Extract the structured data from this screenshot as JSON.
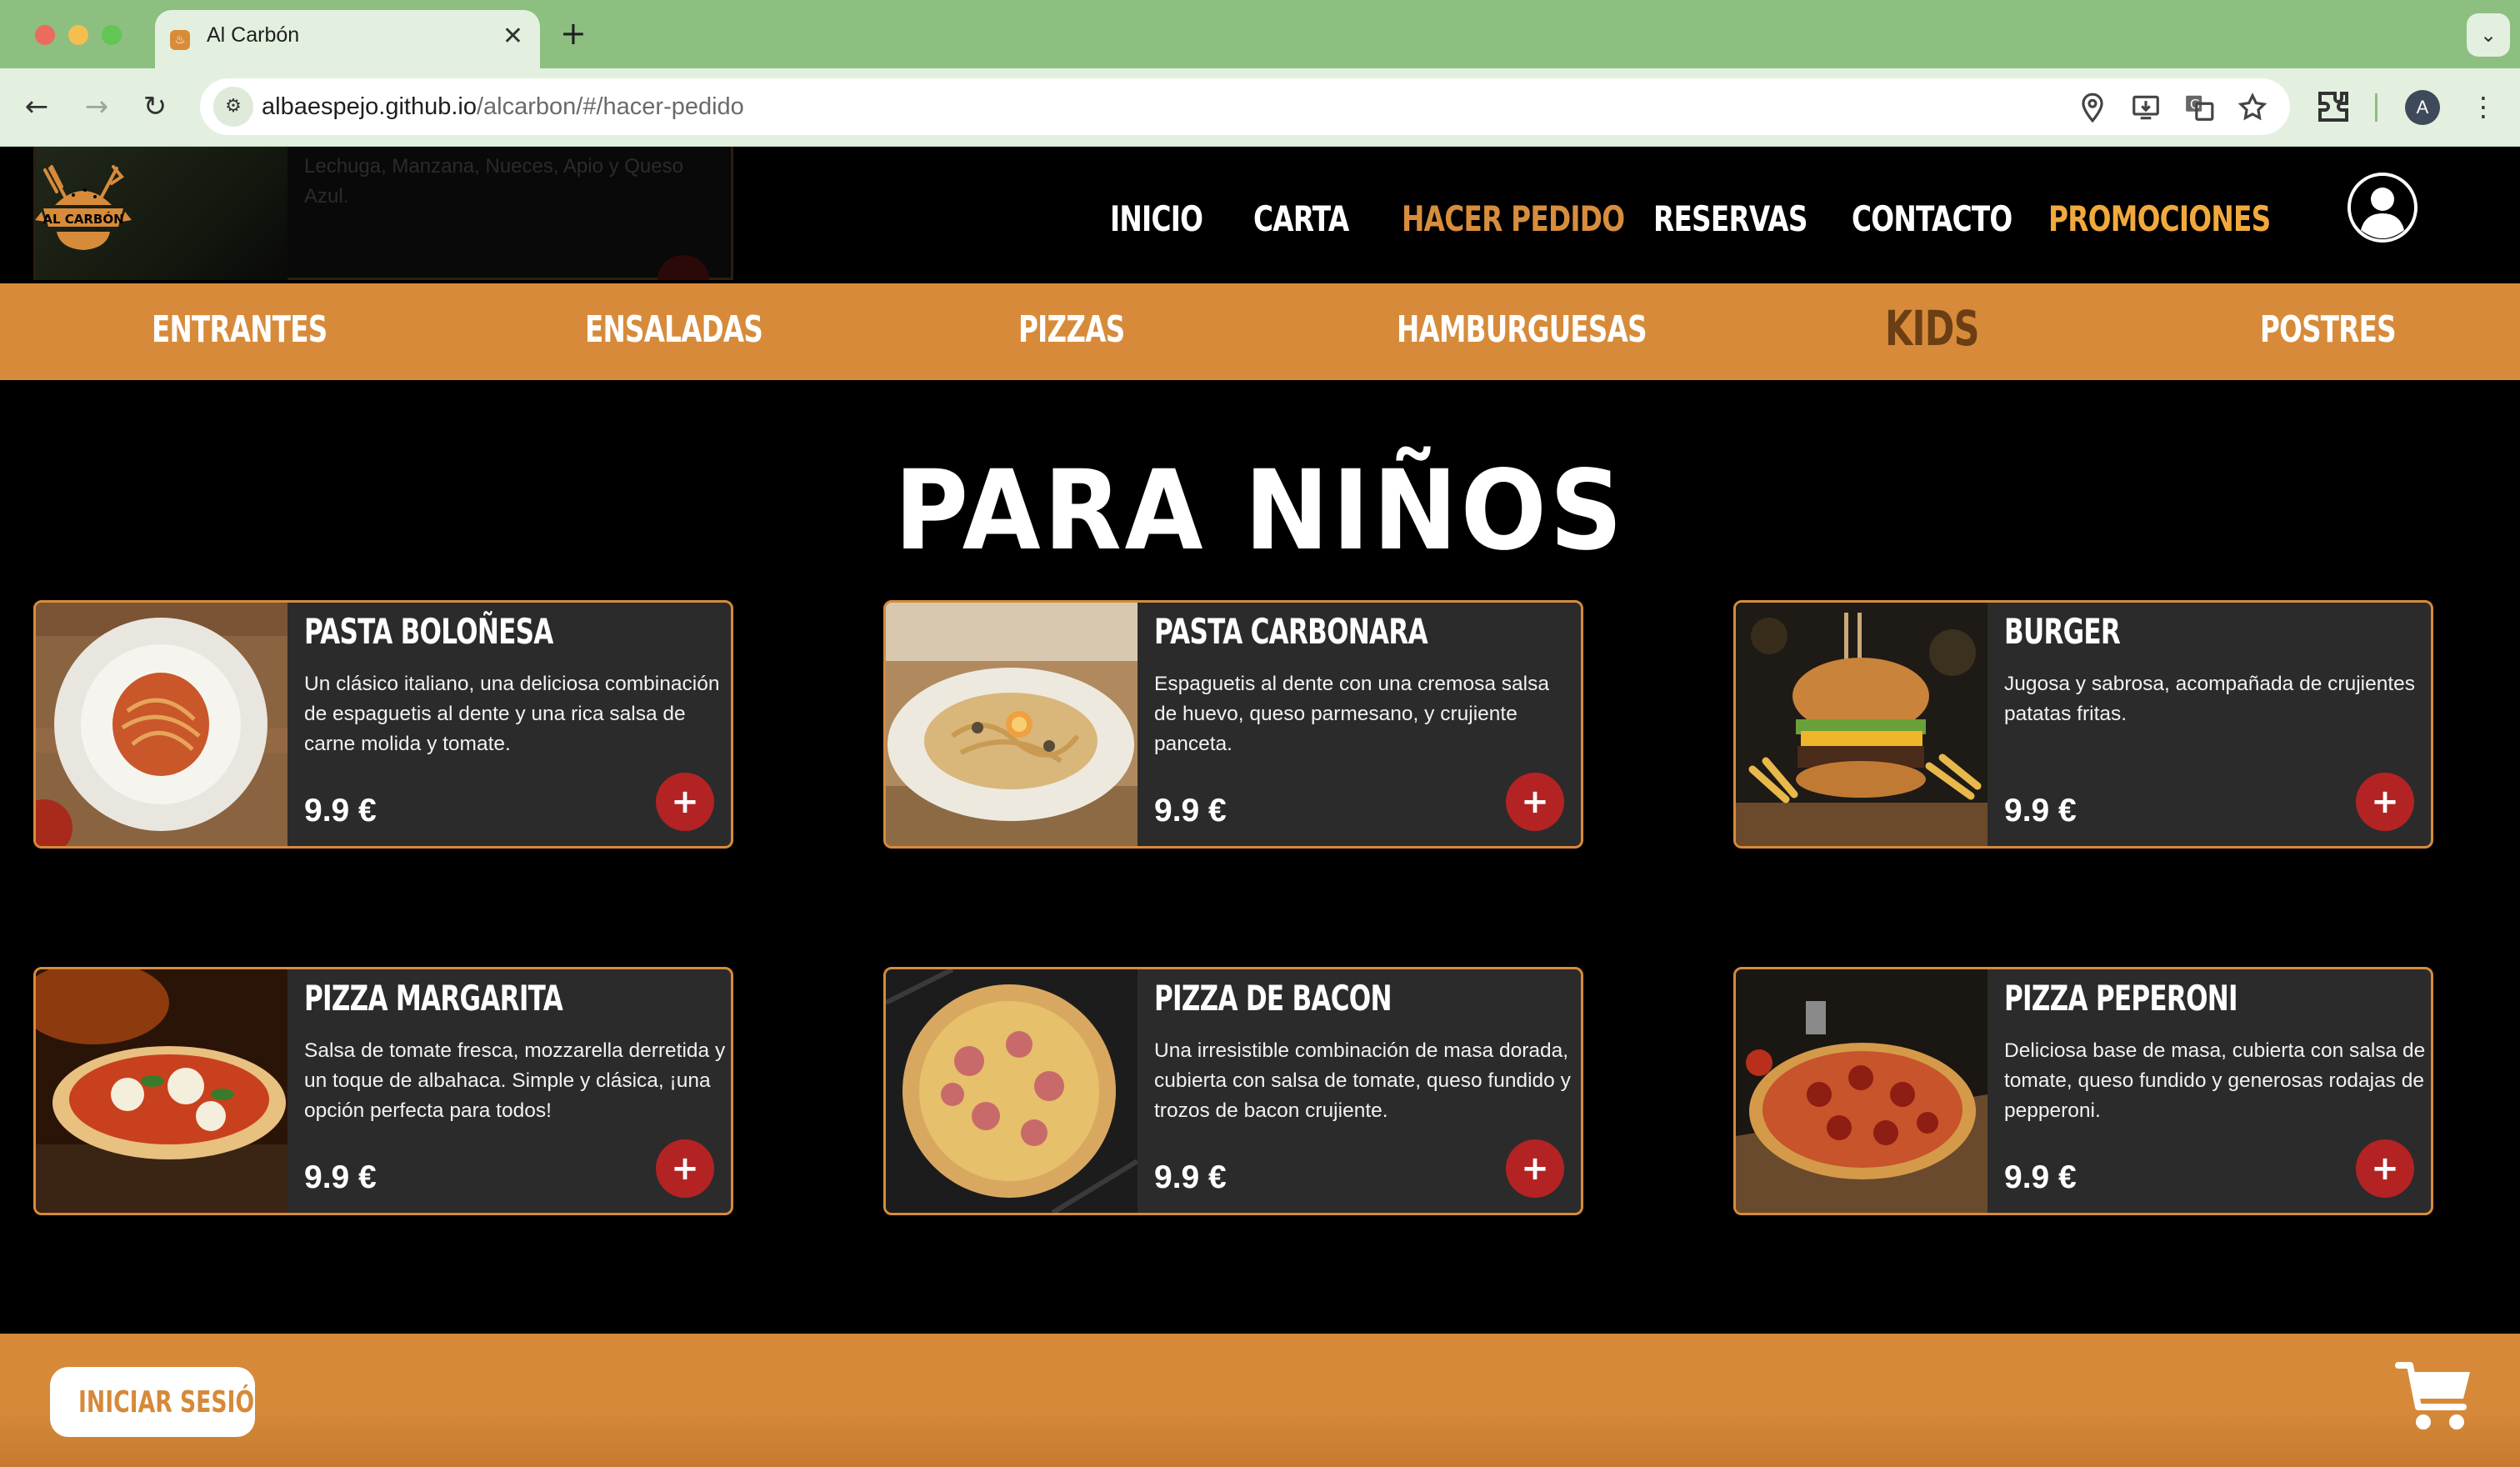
{
  "browser": {
    "tab_title": "Al Carbón",
    "url_host": "albaespejo.github.io",
    "url_path": "/alcarbon/#/hacer-pedido",
    "profile_initial": "A",
    "icons": [
      "back-icon",
      "forward-icon",
      "reload-icon",
      "site-settings-icon",
      "location-icon",
      "install-icon",
      "translate-icon",
      "bookmark-star-icon",
      "extensions-icon",
      "kebab-menu-icon"
    ]
  },
  "behind_card": {
    "desc": "Lechuga, Manzana, Nueces, Apio y Queso Azul."
  },
  "logo": {
    "text": "AL CARBÓN"
  },
  "nav": [
    {
      "label": "INICIO",
      "state": "default"
    },
    {
      "label": "CARTA",
      "state": "default"
    },
    {
      "label": "HACER PEDIDO",
      "state": "active"
    },
    {
      "label": "RESERVAS",
      "state": "default"
    },
    {
      "label": "CONTACTO",
      "state": "default"
    },
    {
      "label": "PROMOCIONES",
      "state": "highlight"
    }
  ],
  "categories": [
    {
      "label": "ENTRANTES"
    },
    {
      "label": "ENSALADAS"
    },
    {
      "label": "PIZZAS"
    },
    {
      "label": "HAMBURGUESAS"
    },
    {
      "label": "KIDS",
      "active": true
    },
    {
      "label": "POSTRES"
    }
  ],
  "section_title": "PARA NIÑOS",
  "products": [
    {
      "name": "PASTA BOLOÑESA",
      "desc": "Un clásico italiano, una deliciosa combinación de espaguetis al dente y una rica salsa de carne molida y tomate.",
      "price": "9.9 €",
      "add": "+"
    },
    {
      "name": "PASTA CARBONARA",
      "desc": "Espaguetis al dente con una cremosa salsa de huevo, queso parmesano, y crujiente panceta.",
      "price": "9.9 €",
      "add": "+"
    },
    {
      "name": "BURGER",
      "desc": "Jugosa y sabrosa, acompañada de crujientes patatas fritas.",
      "price": "9.9 €",
      "add": "+"
    },
    {
      "name": "PIZZA MARGARITA",
      "desc": "Salsa de tomate fresca, mozzarella derretida y un toque de albahaca. Simple y clásica, ¡una opción perfecta para todos!",
      "price": "9.9 €",
      "add": "+"
    },
    {
      "name": "PIZZA DE BACON",
      "desc": "Una irresistible combinación de masa dorada, cubierta con salsa de tomate, queso fundido y trozos de bacon crujiente.",
      "price": "9.9 €",
      "add": "+"
    },
    {
      "name": "PIZZA PEPERONI",
      "desc": "Deliciosa base de masa, cubierta con salsa de tomate, queso fundido y generosas rodajas de pepperoni.",
      "price": "9.9 €",
      "add": "+"
    }
  ],
  "footer": {
    "login_label": "INICIAR SESIÓN"
  },
  "colors": {
    "accent": "#d78b3a",
    "button_red": "#b32323",
    "card_bg": "#2b2b2b",
    "active_category": "#6b3e14"
  }
}
